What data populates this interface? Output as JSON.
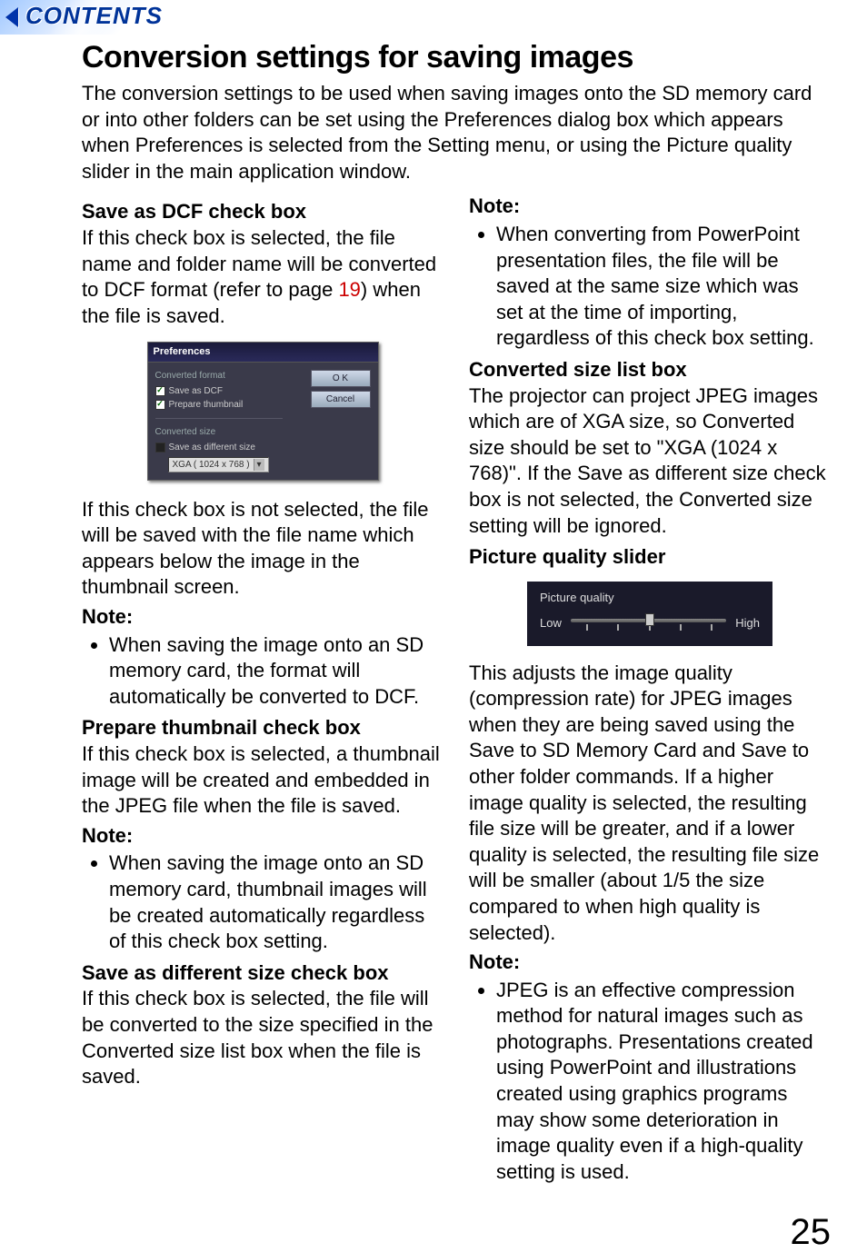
{
  "banner": {
    "label": "CONTENTS"
  },
  "title": "Conversion settings for saving images",
  "intro": "The conversion settings to be used when saving images onto the SD memory card or into other folders can be set using the Preferences dialog box which appears when Preferences is selected from the Setting menu, or using the Picture quality slider in the main application window.",
  "left": {
    "h1": "Save as DCF check box",
    "p1a": "If this check box is selected, the file name and folder name will be converted to DCF format (refer to page ",
    "p1_link": "19",
    "p1b": ") when the file is saved.",
    "p2": "If this check box is not selected, the file will be saved with the file name which appears below the image in the thumbnail screen.",
    "note1_label": "Note:",
    "note1_item": "When saving the image onto an SD memory card, the format will automatically be converted to DCF.",
    "h2": "Prepare thumbnail check box",
    "p3": "If this check box is selected, a thumbnail image will be created and embedded in the JPEG file when the file is saved.",
    "note2_label": "Note:",
    "note2_item": "When saving the image onto an SD memory card, thumbnail images will be created automatically regardless of this check box setting.",
    "h3": "Save as different size check box",
    "p4": "If this check box is selected, the file will be converted to the size specified in the Converted size list box when the file is saved."
  },
  "right": {
    "note3_label": "Note:",
    "note3_item": "When converting from PowerPoint presentation files, the file will be saved at the same size which was set at the time of importing, regardless of this check box setting.",
    "h4": "Converted size list box",
    "p5": "The projector can project JPEG images which are of XGA size, so Converted size should be set to \"XGA (1024 x 768)\". If the Save as different size check box is not selected, the Converted size setting will be ignored.",
    "h5": "Picture quality slider",
    "p6": "This adjusts the image quality (compression rate) for JPEG images when they are being saved using the Save to SD Memory Card and Save to other folder commands. If a higher image quality is selected, the resulting file size will be greater, and if a lower quality is selected, the resulting file size will be smaller (about 1/5 the size compared to when high quality is selected).",
    "note4_label": "Note:",
    "note4_item": "JPEG is an effective compression method for natural images such as photographs. Presentations created using PowerPoint and illustrations created using graphics programs may show some deterioration in image quality even if a high-quality setting is used."
  },
  "prefs": {
    "title": "Preferences",
    "group1": "Converted format",
    "chk1": "Save as DCF",
    "chk2": "Prepare thumbnail",
    "group2": "Converted size",
    "chk3": "Save as different size",
    "size_option": "XGA   ( 1024 x 768 )",
    "ok": "O K",
    "cancel": "Cancel"
  },
  "pq": {
    "title": "Picture quality",
    "low": "Low",
    "high": "High"
  },
  "page_number": "25"
}
